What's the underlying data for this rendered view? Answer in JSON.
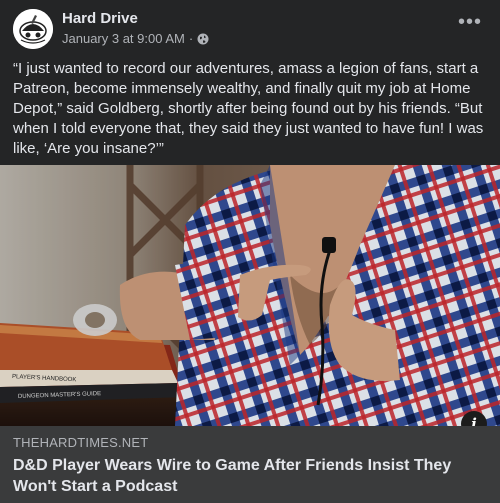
{
  "post": {
    "page_name": "Hard Drive",
    "timestamp": "January 3 at 9:00 AM",
    "separator": "·",
    "privacy_icon": "globe-icon",
    "more_options_icon": "more-horizontal-icon",
    "more_label": "•••",
    "text": "“I just wanted to record our adventures, amass a legion of fans, start a Patreon, become immensely wealthy, and finally quit my job at Home Depot,” said Goldberg, shortly after being found out by his friends. “But when I told everyone that, they said they just wanted to have fun! I was like, ‘Are you insane?’”"
  },
  "photo": {
    "book_top_label": "PLAYER'S HANDBOOK",
    "book_bottom_label": "DUNGEON MASTER'S GUIDE",
    "info_label": "i"
  },
  "link": {
    "domain": "THEHARDTIMES.NET",
    "title": "D&D Player Wears Wire to Game After Friends Insist They Won't Start a Podcast"
  },
  "colors": {
    "background": "#242526",
    "link_box": "#3a3b3c",
    "primary_text": "#e4e6eb",
    "secondary_text": "#b0b3b8"
  }
}
